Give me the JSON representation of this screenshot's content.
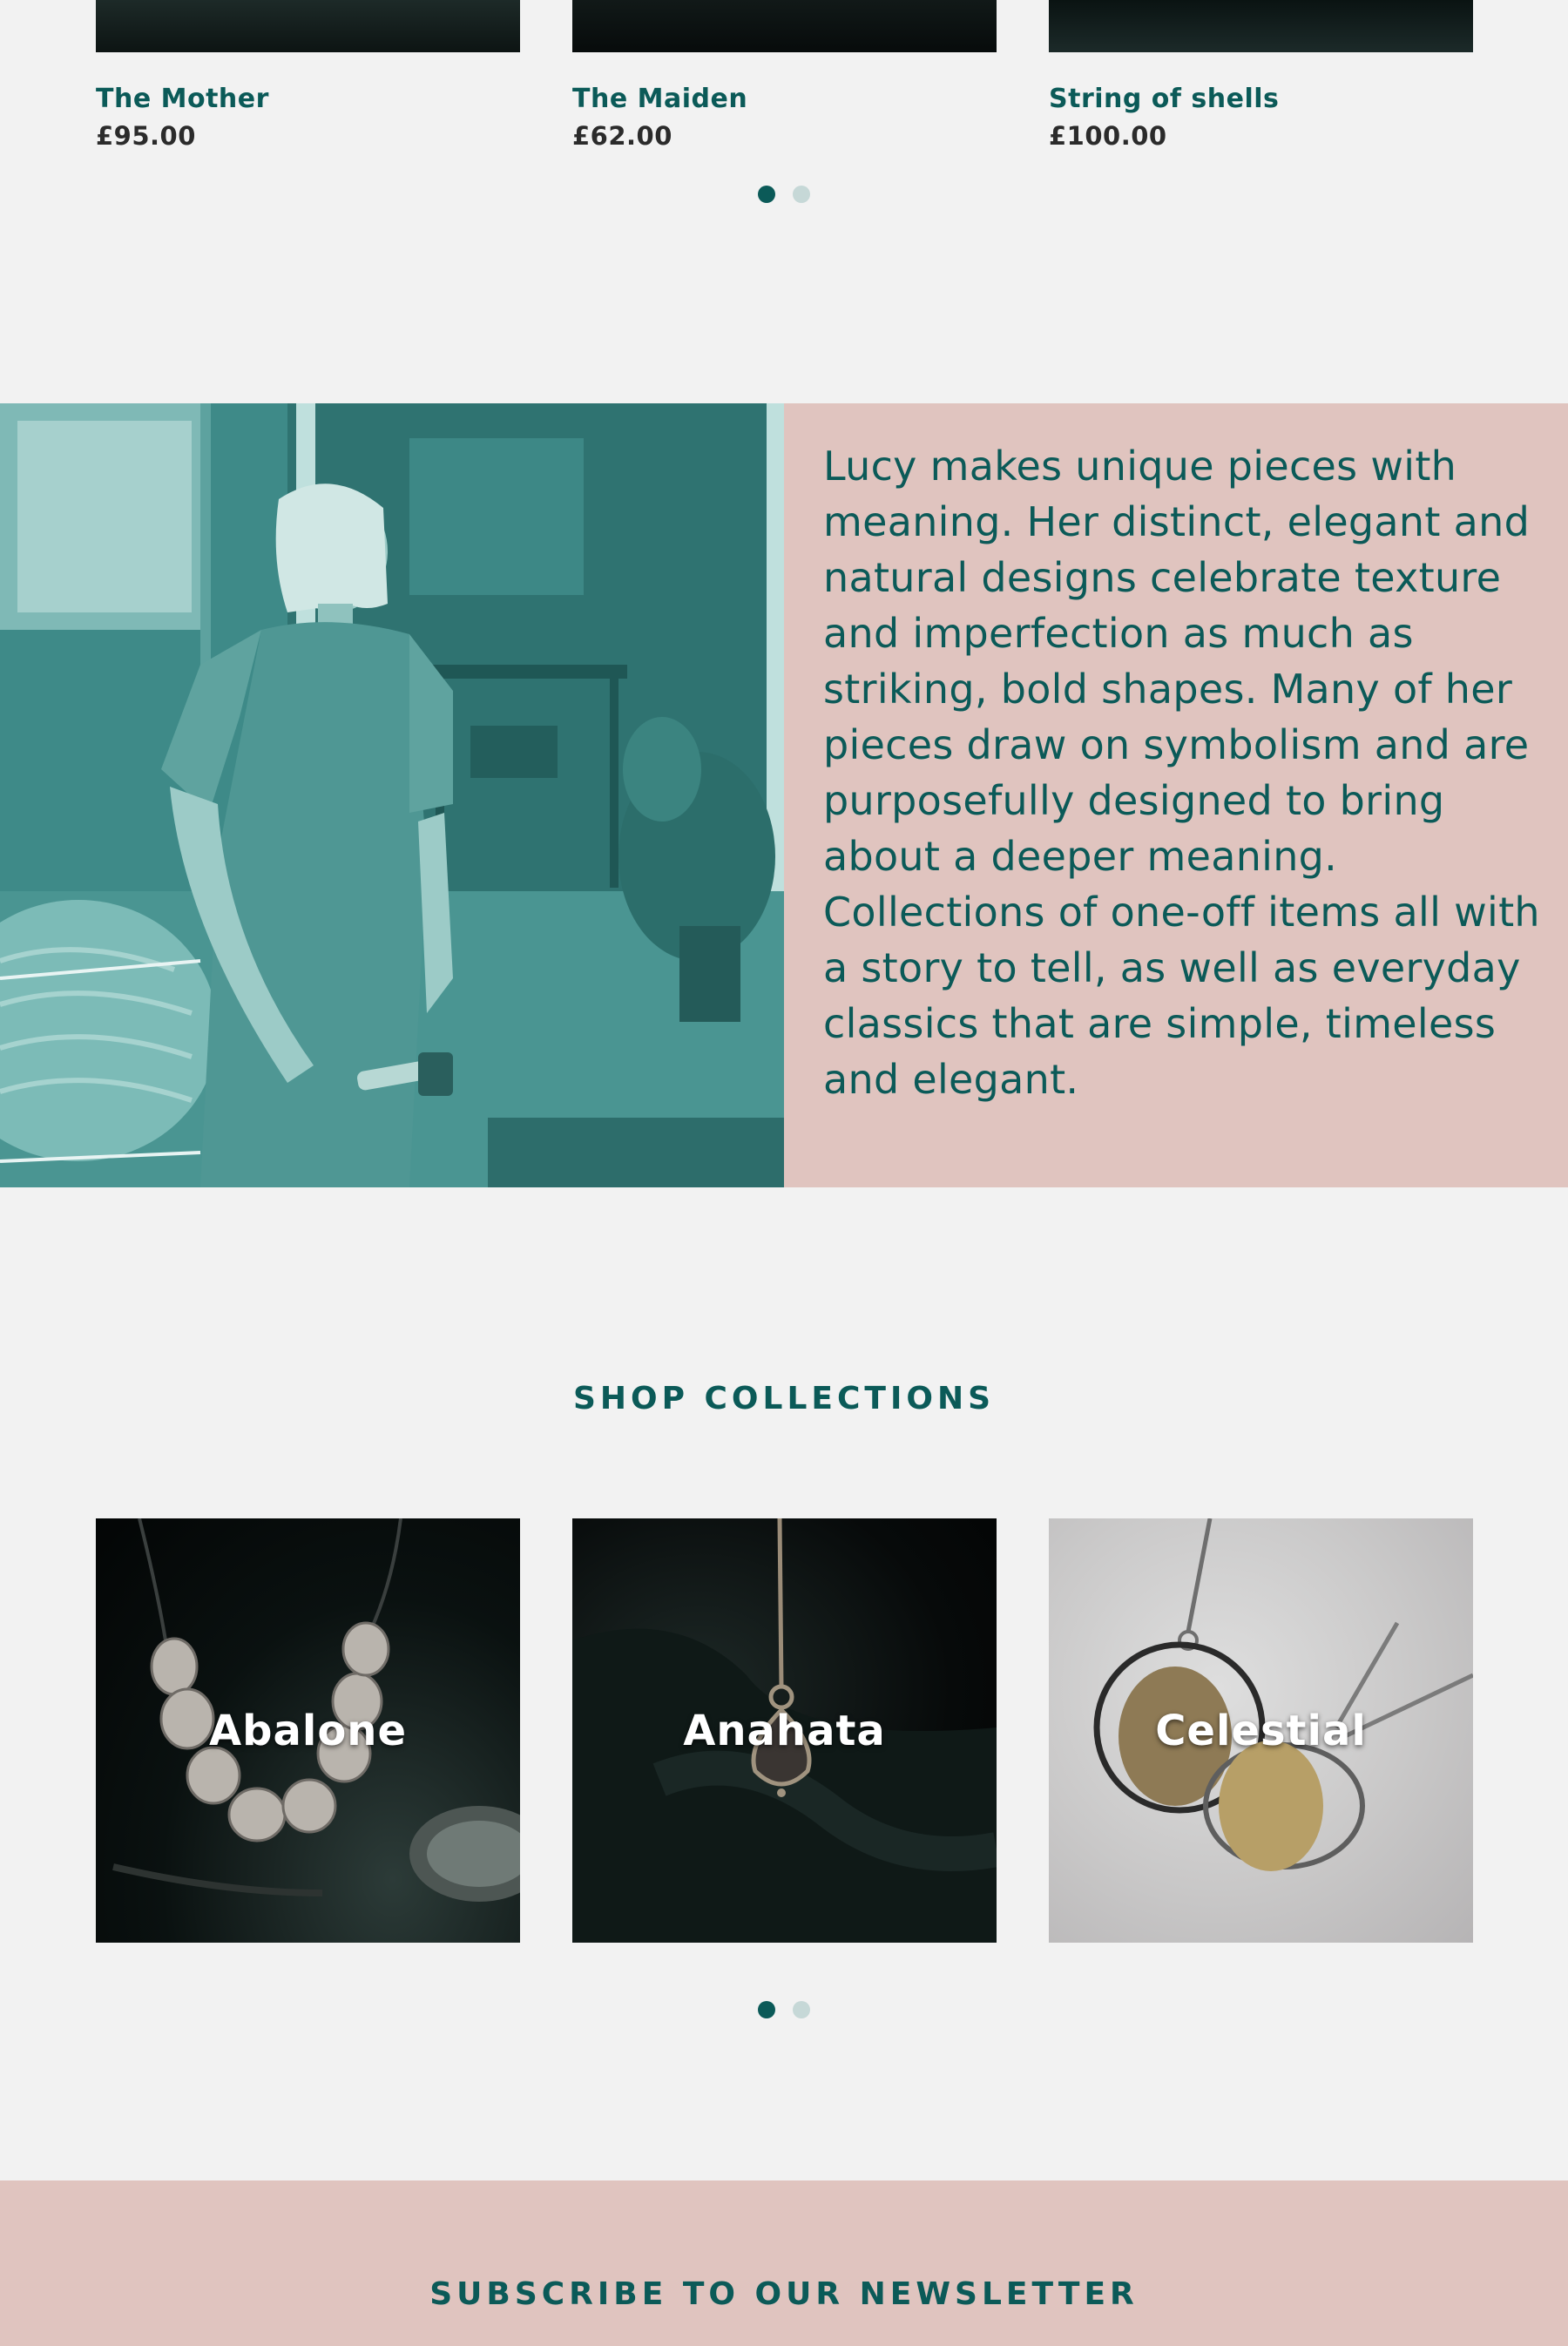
{
  "products": [
    {
      "name": "The Mother",
      "price": "£95.00"
    },
    {
      "name": "The Maiden",
      "price": "£62.00"
    },
    {
      "name": "String of shells",
      "price": "£100.00"
    }
  ],
  "about": {
    "text": " Lucy makes unique pieces with meaning. Her distinct, elegant and natural designs celebrate texture and imperfection as much as striking, bold shapes.  Many of her pieces draw on symbolism and are purposefully designed to bring about a deeper meaning. Collections of one-off items all with a story to tell, as well as everyday classics that are simple, timeless and elegant."
  },
  "collections": {
    "title": "SHOP COLLECTIONS",
    "items": [
      {
        "label": "Abalone"
      },
      {
        "label": "Anahata"
      },
      {
        "label": "Celestial"
      }
    ]
  },
  "newsletter": {
    "title": "SUBSCRIBE TO OUR NEWSLETTER"
  },
  "colors": {
    "brand_teal": "#0b5a58",
    "blush": "#e0c4bf",
    "background": "#f2f2f2",
    "dot_inactive": "#c6d8d7"
  }
}
